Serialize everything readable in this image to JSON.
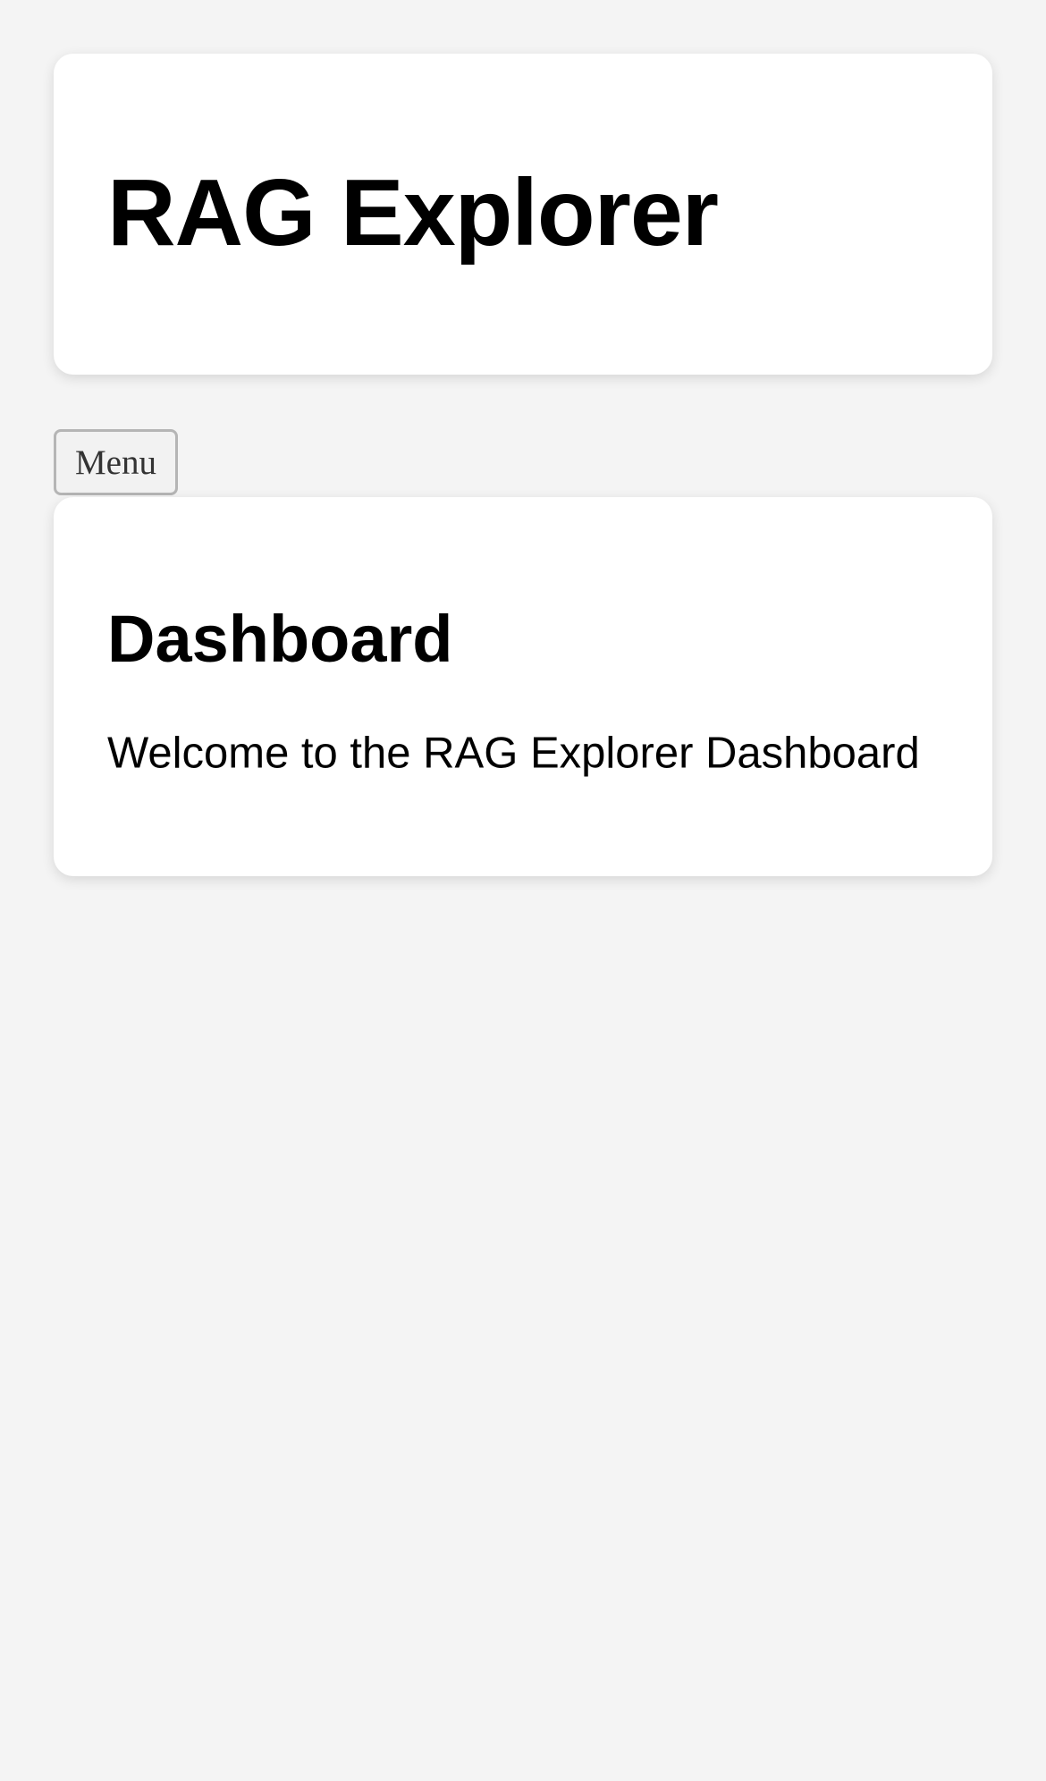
{
  "header": {
    "title": "RAG Explorer"
  },
  "nav": {
    "menu_label": "Menu"
  },
  "main": {
    "heading": "Dashboard",
    "welcome": "Welcome to the RAG Explorer Dashboard"
  },
  "colors": {
    "page_background": "#f4f4f4",
    "card_background": "#ffffff",
    "text": "#000000",
    "button_background": "#f2f2f2",
    "button_border": "#b5b5b5",
    "button_text": "#333333"
  }
}
